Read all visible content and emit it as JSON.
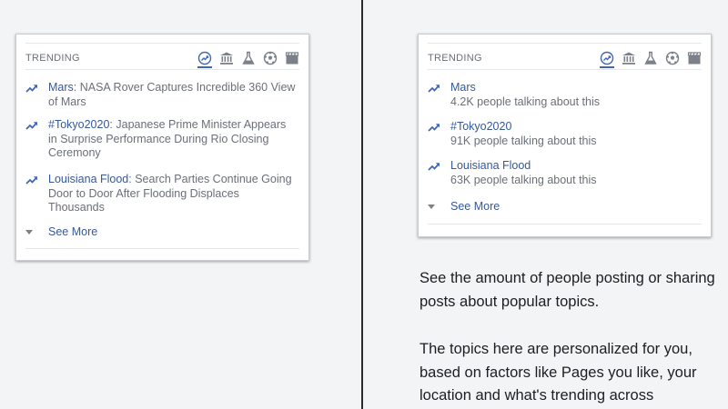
{
  "colors": {
    "link": "#365899",
    "accent": "#4267b2",
    "muted": "#6a6f78",
    "background": "#f3f4f6"
  },
  "header_icons": [
    "trending-icon",
    "politics-icon",
    "science-icon",
    "sports-icon",
    "entertainment-icon"
  ],
  "left_panel": {
    "header": "TRENDING",
    "items": [
      {
        "topic": "Mars",
        "separator": ": ",
        "headline": "NASA Rover Captures Incredible 360 View of Mars"
      },
      {
        "topic": "#Tokyo2020",
        "separator": ": ",
        "headline": "Japanese Prime Minister Appears in Surprise Performance During Rio Closing Ceremony"
      },
      {
        "topic": "Louisiana Flood",
        "separator": ": ",
        "headline": "Search Parties Continue Going Door to Door After Flooding Displaces Thousands"
      }
    ],
    "see_more": "See More"
  },
  "right_panel": {
    "header": "TRENDING",
    "items": [
      {
        "topic": "Mars",
        "subtitle": "4.2K people talking about this"
      },
      {
        "topic": "#Tokyo2020",
        "subtitle": "91K people talking about this"
      },
      {
        "topic": "Louisiana Flood",
        "subtitle": "63K people talking about this"
      }
    ],
    "see_more": "See More",
    "explanation_1": "See the amount of people posting or sharing posts about popular topics.",
    "explanation_2": "The topics here are personalized for you, based on factors like Pages you like, your location and what's trending across"
  }
}
